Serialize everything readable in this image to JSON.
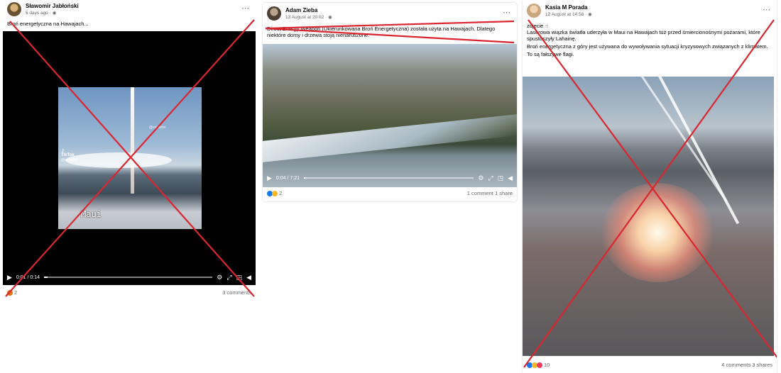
{
  "posts": [
    {
      "author": "Sławomir Jabłoński",
      "meta": "5 days ago · ",
      "text": "Broń energetyczna na Hawajach...",
      "video": {
        "overlay_caption": "Maui",
        "tiktok_label": "TikTok",
        "tiktok_user": "@calibebo",
        "watermark": "@calibebo",
        "time": "0:01 / 0:14",
        "progress": 0.02
      },
      "reaction_count": "2",
      "counts": "3 comments"
    },
    {
      "author": "Adam Zieba",
      "meta": "13 August at 20:02 · ",
      "text": "Direct Energy Weapon (Ukierunkowana Broń Energetyczna) została użyta na Hawajach. Dlatego niektóre domy i drzewa stoją nienaruszone.",
      "video": {
        "time": "0:04 / 7:21",
        "progress": 0.01
      },
      "reaction_count": "2",
      "counts": "1 comment  1 share"
    },
    {
      "author": "Kasia M Porada",
      "meta": "12 August at 14:58 · ",
      "text_lines": [
        "zdjęcie ☝",
        "Laserowa wiązka światła uderzyła w Maui na Hawajach tuż przed śmiercionośnymi pożarami, które spustoszyły Lahainę.",
        "Broń energetyczna z góry jest używana do wywoływania sytuacji kryzysowych związanych z klimatem.",
        "To są fałszywe flagi."
      ],
      "reaction_count": "10",
      "counts": "4 comments  3 shares"
    }
  ],
  "icons": {
    "more": "⋯",
    "globe": "🌐",
    "play": "▶",
    "settings": "⚙",
    "expand": "⤢",
    "pip": "◳",
    "volume": "🔊"
  },
  "colors": {
    "cross": "#d9262f",
    "like": "#1877f2",
    "care": "#f7b928",
    "love": "#f33e58",
    "angry": "#e9710f"
  }
}
